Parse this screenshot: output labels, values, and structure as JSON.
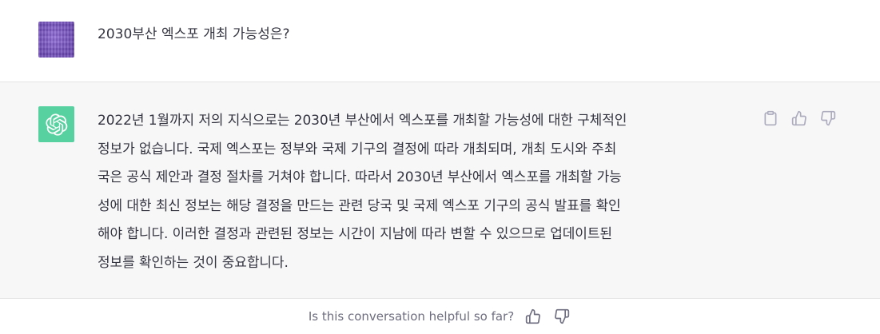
{
  "user_message": {
    "text": "2030부산 엑스포 개최 가능성은?"
  },
  "assistant_message": {
    "lines": [
      "2022년 1월까지 저의 지식으로는 2030년 부산에서 엑스포를 개최할 가능성에 대한 구체적인",
      "정보가 없습니다. 국제 엑스포는 정부와 국제 기구의 결정에 따라 개최되며, 개최 도시와 주최",
      "국은 공식 제안과 결정 절차를 거쳐야 합니다. 따라서 2030년 부산에서 엑스포를 개최할 가능",
      "성에 대한 최신 정보는 해당 결정을 만드는 관련 당국 및 국제 엑스포 기구의 공식 발표를 확인",
      "해야 합니다. 이러한 결정과 관련된 정보는 시간이 지남에 따라 변할 수 있으므로 업데이트된",
      "정보를 확인하는 것이 중요합니다."
    ]
  },
  "actions": {
    "copy_icon": "clipboard-icon",
    "thumbs_up_icon": "thumbs-up-icon",
    "thumbs_down_icon": "thumbs-down-icon"
  },
  "feedback": {
    "prompt": "Is this conversation helpful so far?"
  },
  "colors": {
    "user_avatar": "#7b5bc4",
    "assistant_avatar": "#19c37d",
    "assistant_bg": "#f7f7f8",
    "text": "#343541",
    "muted": "#6e6e80"
  }
}
